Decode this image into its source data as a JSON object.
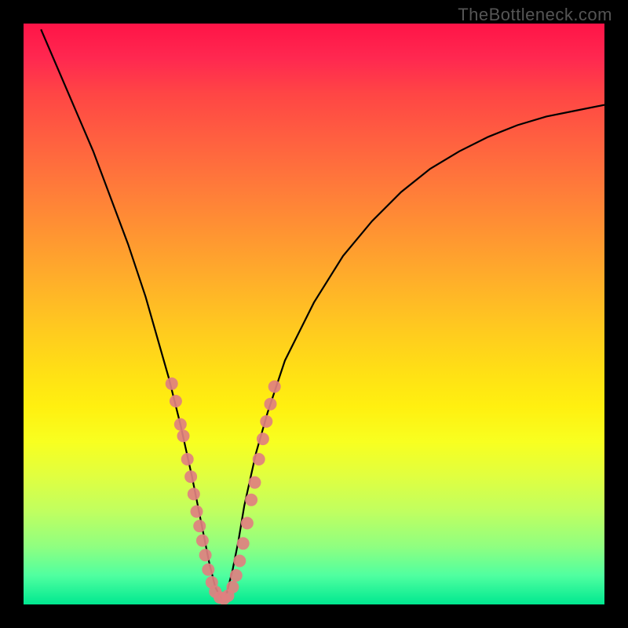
{
  "watermark": "TheBottleneck.com",
  "chart_data": {
    "type": "line",
    "title": "",
    "xlabel": "",
    "ylabel": "",
    "xlim": [
      0,
      100
    ],
    "ylim": [
      0,
      100
    ],
    "description": "V-shaped bottleneck curve over rainbow gradient; y rises from green (good) to red (bad). Minimum near x≈34.",
    "series": [
      {
        "name": "bottleneck-curve",
        "x": [
          3,
          6,
          9,
          12,
          15,
          18,
          21,
          23,
          25,
          27,
          29,
          30,
          31,
          32,
          33,
          34,
          35,
          36,
          37,
          38,
          40,
          42,
          45,
          50,
          55,
          60,
          65,
          70,
          75,
          80,
          85,
          90,
          95,
          100
        ],
        "y": [
          99,
          92,
          85,
          78,
          70,
          62,
          53,
          46,
          39,
          31,
          22,
          17,
          12,
          7,
          3,
          1,
          2,
          6,
          11,
          17,
          26,
          33,
          42,
          52,
          60,
          66,
          71,
          75,
          78,
          80.5,
          82.5,
          84,
          85,
          86
        ]
      }
    ],
    "scatter_points": {
      "name": "highlight-dots",
      "color": "#e08080",
      "points": [
        {
          "x": 25.5,
          "y": 38
        },
        {
          "x": 26.2,
          "y": 35
        },
        {
          "x": 27.0,
          "y": 31
        },
        {
          "x": 27.5,
          "y": 29
        },
        {
          "x": 28.2,
          "y": 25
        },
        {
          "x": 28.8,
          "y": 22
        },
        {
          "x": 29.3,
          "y": 19
        },
        {
          "x": 29.8,
          "y": 16
        },
        {
          "x": 30.3,
          "y": 13.5
        },
        {
          "x": 30.8,
          "y": 11
        },
        {
          "x": 31.3,
          "y": 8.5
        },
        {
          "x": 31.8,
          "y": 6
        },
        {
          "x": 32.4,
          "y": 3.8
        },
        {
          "x": 33.0,
          "y": 2.2
        },
        {
          "x": 33.8,
          "y": 1.2
        },
        {
          "x": 34.5,
          "y": 1.0
        },
        {
          "x": 35.2,
          "y": 1.5
        },
        {
          "x": 36.0,
          "y": 3.0
        },
        {
          "x": 36.6,
          "y": 5.0
        },
        {
          "x": 37.2,
          "y": 7.5
        },
        {
          "x": 37.8,
          "y": 10.5
        },
        {
          "x": 38.5,
          "y": 14
        },
        {
          "x": 39.2,
          "y": 18
        },
        {
          "x": 39.8,
          "y": 21
        },
        {
          "x": 40.5,
          "y": 25
        },
        {
          "x": 41.2,
          "y": 28.5
        },
        {
          "x": 41.8,
          "y": 31.5
        },
        {
          "x": 42.5,
          "y": 34.5
        },
        {
          "x": 43.2,
          "y": 37.5
        }
      ]
    }
  }
}
